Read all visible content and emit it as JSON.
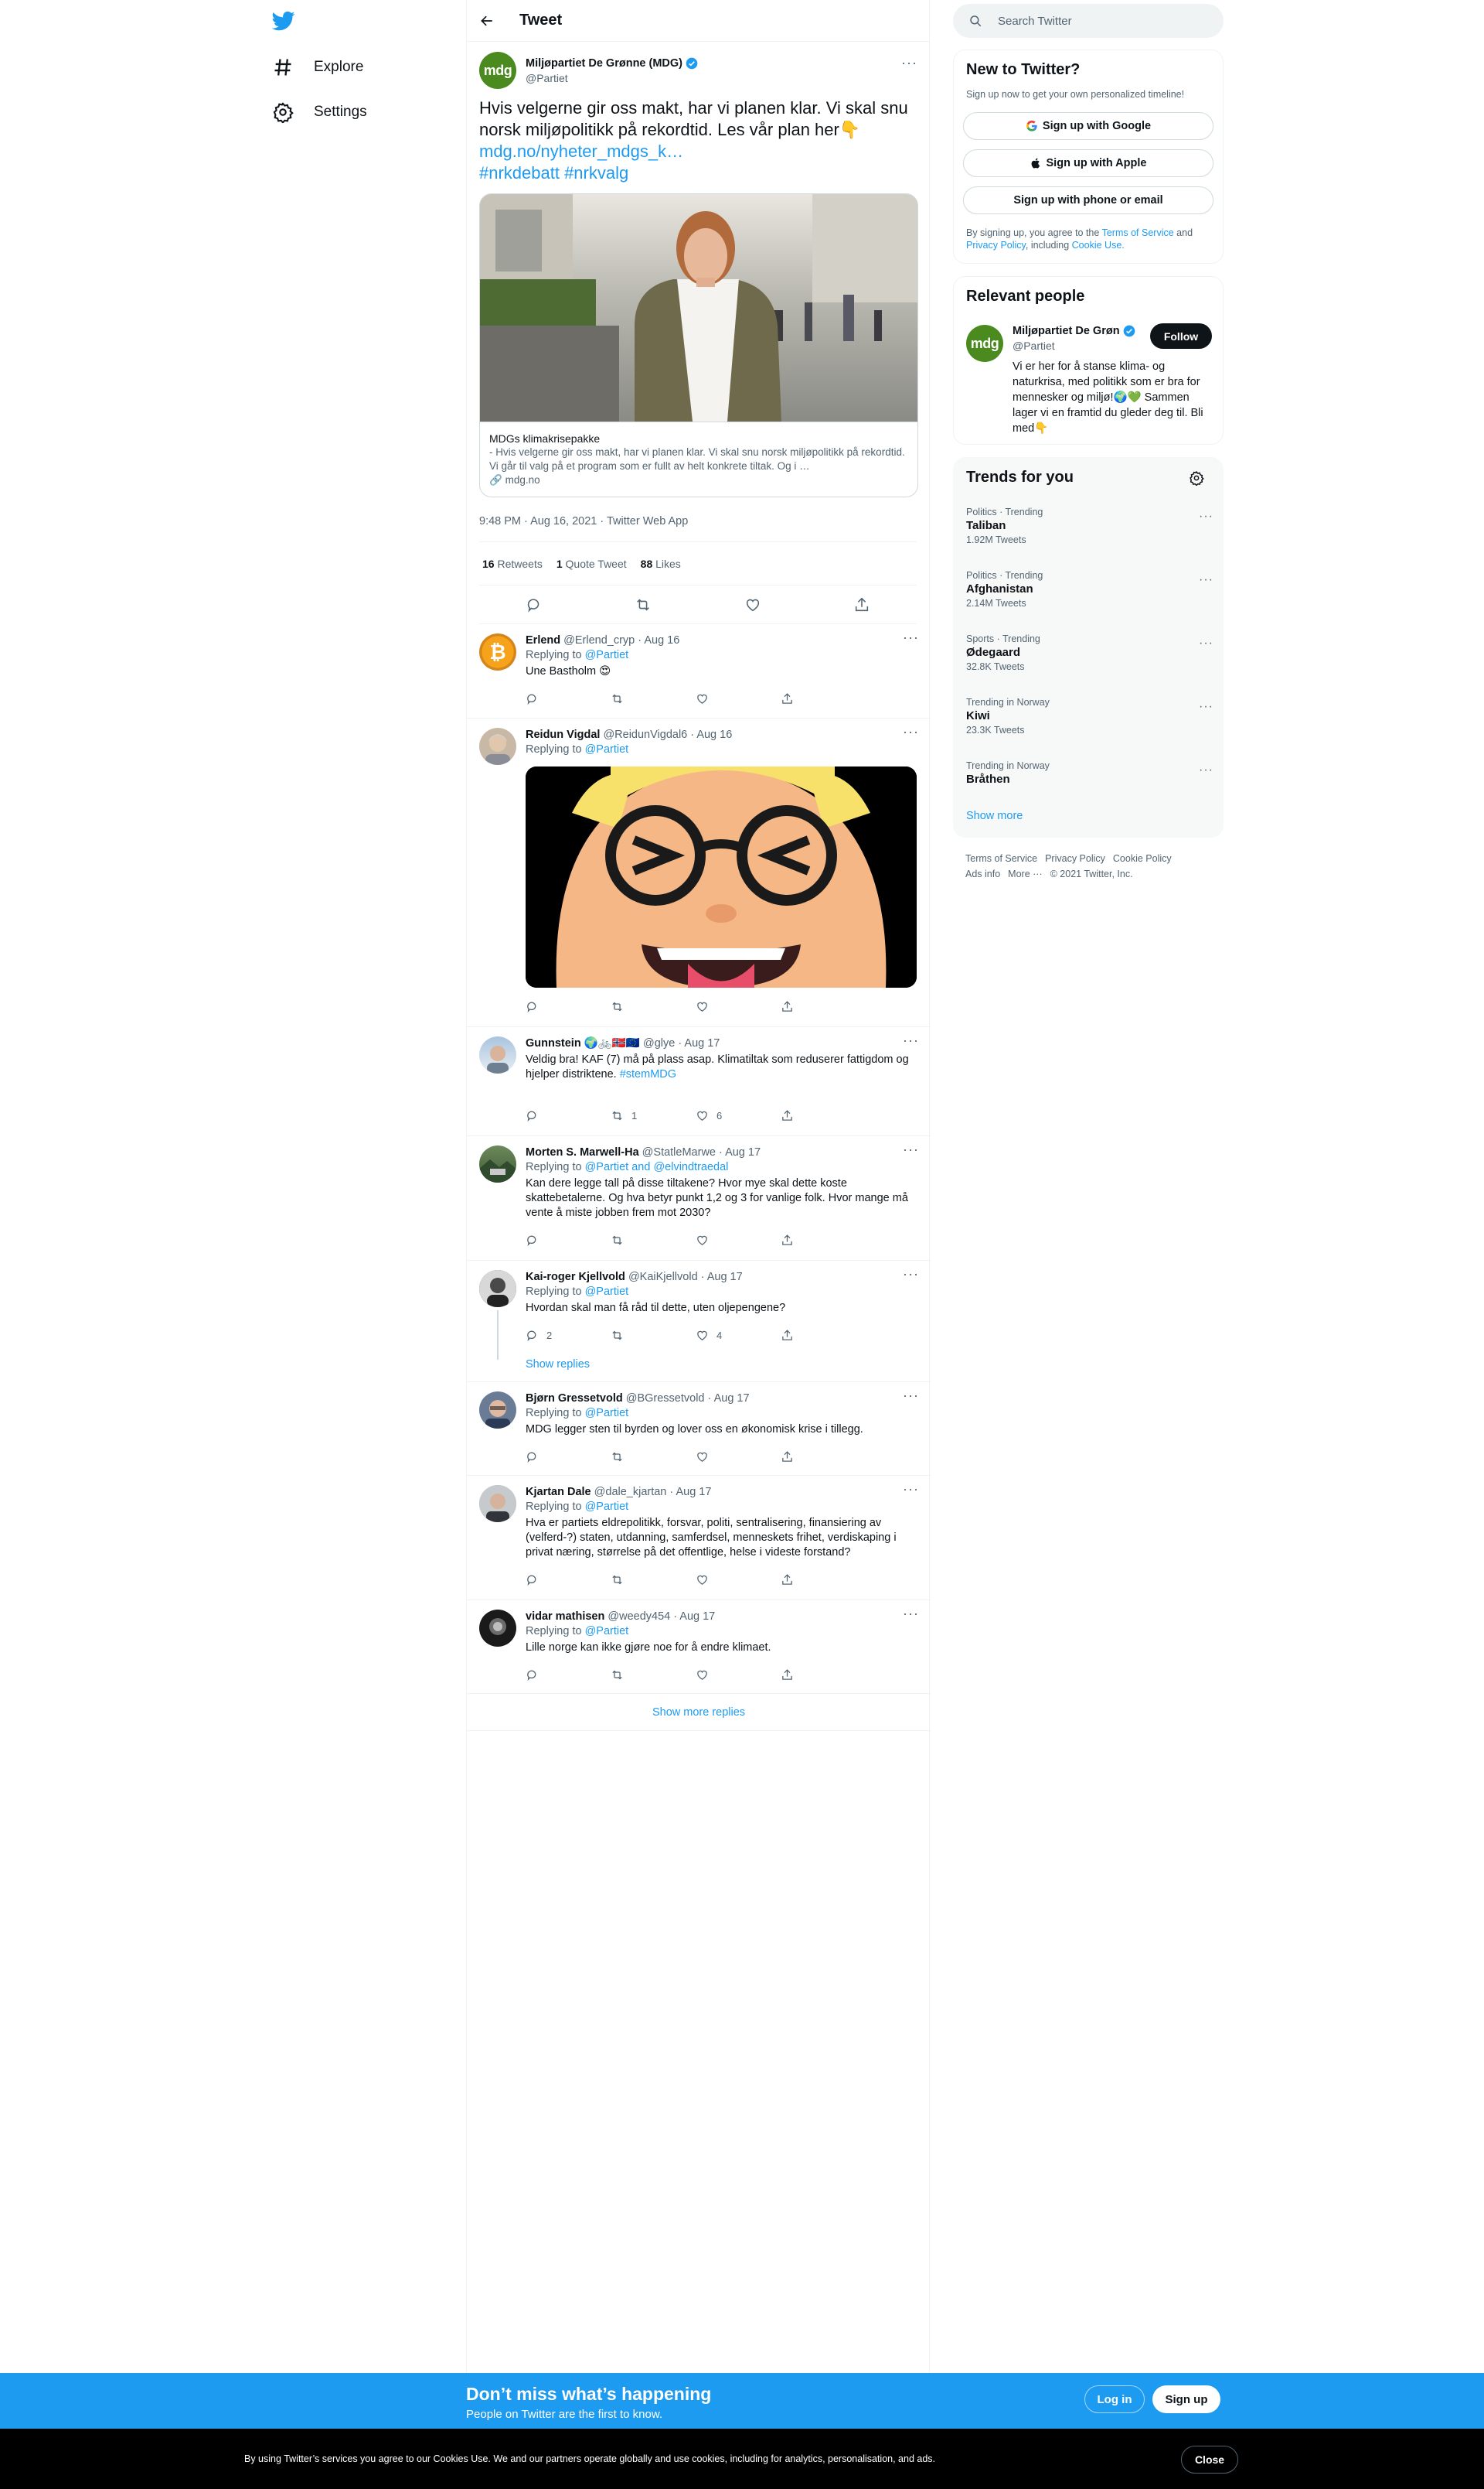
{
  "nav": {
    "explore": "Explore",
    "settings": "Settings"
  },
  "header": {
    "title": "Tweet"
  },
  "tweet": {
    "name": "Miljøpartiet De Grønne (MDG)",
    "handle": "@Partiet",
    "avatar_text": "mdg",
    "text": "Hvis velgerne gir oss makt, har vi planen klar. Vi skal snu norsk miljøpolitikk på rekordtid. Les vår plan her👇",
    "link": "mdg.no/nyheter_mdgs_k…",
    "hashtags": "#nrkdebatt #nrkvalg",
    "card": {
      "title": "MDGs klimakrisepakke",
      "description": "- Hvis velgerne gir oss makt, har vi planen klar. Vi skal snu norsk miljøpolitikk på rekordtid. Vi går til valg på et program som er fullt av helt konkrete tiltak. Og i …",
      "domain": "mdg.no"
    },
    "meta": "9:48 PM · Aug 16, 2021 · Twitter Web App",
    "retweets": "16",
    "retweets_label": "Retweets",
    "quotes": "1",
    "quotes_label": "Quote Tweet",
    "likes": "88",
    "likes_label": "Likes"
  },
  "replies": [
    {
      "name": "Erlend",
      "handle": "@Erlend_cryp",
      "date": "· Aug 16",
      "replying": "Replying to",
      "to": "@Partiet",
      "text": "Une Bastholm 😍",
      "replies": "",
      "retweets": "",
      "likes": ""
    },
    {
      "name": "Reidun Vigdal",
      "handle": "@ReidunVigdal6",
      "date": "· Aug 16",
      "replying": "Replying to",
      "to": "@Partiet",
      "text": "",
      "replies": "",
      "retweets": "",
      "likes": ""
    },
    {
      "name": "Gunnstein 🌍🚲🇳🇴🇪🇺",
      "handle": "@glye",
      "date": "· Aug 17",
      "replying": "",
      "to": "",
      "text": "Veldig bra! KAF (7) må på plass asap. Klimatiltak som reduserer fattigdom og hjelper distriktene.",
      "hashtag": "#stemMDG",
      "replies": "",
      "retweets": "1",
      "likes": "6"
    },
    {
      "name": "Morten S. Marwell-Ha",
      "handle": "@StatleMarwe",
      "date": "· Aug 17",
      "replying": "Replying to",
      "to": "@Partiet and @elvindtraedal",
      "text": "Kan dere legge tall på disse tiltakene? Hvor mye skal dette koste skattebetalerne. Og hva betyr punkt 1,2 og 3 for vanlige folk. Hvor mange må vente å miste jobben frem mot 2030?",
      "replies": "",
      "retweets": "",
      "likes": ""
    },
    {
      "name": "Kai-roger Kjellvold",
      "handle": "@KaiKjellvold",
      "date": "· Aug 17",
      "replying": "Replying to",
      "to": "@Partiet",
      "text": "Hvordan skal man få råd til dette, uten oljepengene?",
      "replies": "2",
      "retweets": "",
      "likes": "4",
      "show_replies": "Show replies"
    },
    {
      "name": "Bjørn Gressetvold",
      "handle": "@BGressetvold",
      "date": "· Aug 17",
      "replying": "Replying to",
      "to": "@Partiet",
      "text": "MDG legger sten til byrden og lover oss en økonomisk krise i tillegg.",
      "replies": "",
      "retweets": "",
      "likes": ""
    },
    {
      "name": "Kjartan Dale",
      "handle": "@dale_kjartan",
      "date": "· Aug 17",
      "replying": "Replying to",
      "to": "@Partiet",
      "text": "Hva er partiets eldrepolitikk, forsvar, politi, sentralisering, finansiering av (velferd-?) staten, utdanning, samferdsel, menneskets frihet, verdiskaping i privat næring, størrelse på det offentlige, helse i videste forstand?",
      "replies": "",
      "retweets": "",
      "likes": ""
    },
    {
      "name": "vidar mathisen",
      "handle": "@weedy454",
      "date": "· Aug 17",
      "replying": "Replying to",
      "to": "@Partiet",
      "text": "Lille norge kan ikke gjøre noe for å endre klimaet.",
      "replies": "",
      "retweets": "",
      "likes": ""
    }
  ],
  "show_more": "Show more replies",
  "search": {
    "placeholder": "Search Twitter"
  },
  "new_to_twitter": {
    "title": "New to Twitter?",
    "subtitle": "Sign up now to get your own personalized timeline!",
    "google": "Sign up with Google",
    "apple": "Sign up with Apple",
    "phone": "Sign up with phone or email",
    "terms_pre": "By signing up, you agree to the",
    "terms": "Terms of Service",
    "and": "and",
    "privacy": "Privacy Policy",
    "including": ", including",
    "cookie": "Cookie Use."
  },
  "relevant": {
    "title": "Relevant people",
    "name": "Miljøpartiet De Grøn",
    "handle": "@Partiet",
    "follow": "Follow",
    "bio": "Vi er her for å stanse klima- og naturkrisa, med politikk som er bra for mennesker og miljø!🌍💚 Sammen lager vi en framtid du gleder deg til. Bli med👇"
  },
  "trends": {
    "title": "Trends for you",
    "items": [
      {
        "context": "Politics · Trending",
        "name": "Taliban",
        "count": "1.92M Tweets"
      },
      {
        "context": "Politics · Trending",
        "name": "Afghanistan",
        "count": "2.14M Tweets"
      },
      {
        "context": "Sports · Trending",
        "name": "Ødegaard",
        "count": "32.8K Tweets"
      },
      {
        "context": "Trending in Norway",
        "name": "Kiwi",
        "count": "23.3K Tweets"
      },
      {
        "context": "Trending in Norway",
        "name": "Bråthen",
        "count": ""
      }
    ],
    "show_more": "Show more"
  },
  "footer": {
    "terms": "Terms of Service",
    "privacy": "Privacy Policy",
    "cookie": "Cookie Policy",
    "ads": "Ads info",
    "more": "More ···",
    "copyright": "© 2021 Twitter, Inc."
  },
  "signup_bar": {
    "title": "Don’t miss what’s happening",
    "subtitle": "People on Twitter are the first to know.",
    "login": "Log in",
    "signup": "Sign up"
  },
  "cookie_bar": {
    "text": "By using Twitter’s services you agree to our Cookies Use. We and our partners operate globally and use cookies, including for analytics, personalisation, and ads.",
    "close": "Close"
  },
  "colors": {
    "brand": "#1d9bf0",
    "text": "#0f1419",
    "muted": "#536471",
    "mdg_green": "#4b8a1f"
  }
}
